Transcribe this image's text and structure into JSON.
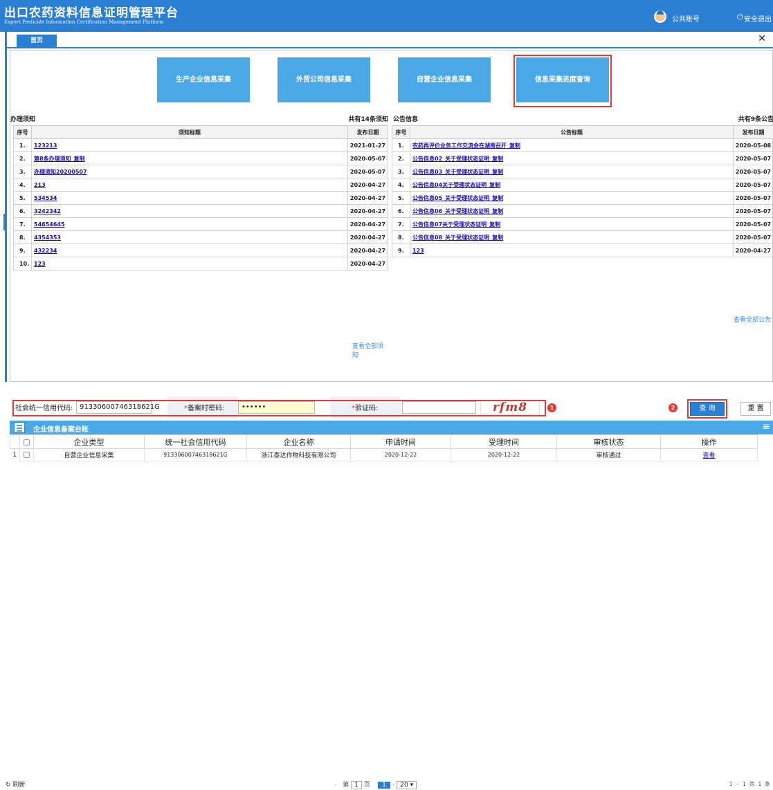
{
  "header": {
    "title": "出口农药资料信息证明管理平台",
    "subtitle": "Export Pesticide Information Certification Management Platform",
    "user_label": "公共账号",
    "logout_label": "安全退出"
  },
  "tabs": [
    {
      "label": "首页"
    }
  ],
  "tiles": [
    {
      "label": "生产企业信息采集"
    },
    {
      "label": "外贸公司信息采集"
    },
    {
      "label": "自营企业信息采集"
    },
    {
      "label": "信息采集进度查询"
    }
  ],
  "notice_panel": {
    "title": "办理须知",
    "count": "共有14条须知",
    "col_index": "序号",
    "col_title": "须知标题",
    "col_date": "发布日期",
    "more": "查看全部须知",
    "rows": [
      {
        "idx": "1.",
        "title": "123213",
        "date": "2021-01-27"
      },
      {
        "idx": "2.",
        "title": "第8条办理须知_复制",
        "date": "2020-05-07"
      },
      {
        "idx": "3.",
        "title": "办理须知20200507",
        "date": "2020-05-07"
      },
      {
        "idx": "4.",
        "title": "213",
        "date": "2020-04-27"
      },
      {
        "idx": "5.",
        "title": "534534",
        "date": "2020-04-27"
      },
      {
        "idx": "6.",
        "title": "3242342",
        "date": "2020-04-27"
      },
      {
        "idx": "7.",
        "title": "54654645",
        "date": "2020-04-27"
      },
      {
        "idx": "8.",
        "title": "4354353",
        "date": "2020-04-27"
      },
      {
        "idx": "9.",
        "title": "432234",
        "date": "2020-04-27"
      },
      {
        "idx": "10.",
        "title": "123",
        "date": "2020-04-27"
      }
    ]
  },
  "announce_panel": {
    "title": "公告信息",
    "count": "共有9条公告",
    "col_index": "序号",
    "col_title": "公告标题",
    "col_date": "发布日期",
    "more": "查看全部公告",
    "rows": [
      {
        "idx": "1.",
        "title": "农药再评价业务工作交流会在湖南召开_复制",
        "date": "2020-05-08"
      },
      {
        "idx": "2.",
        "title": "公告信息02_关于受理状态证明_复制",
        "date": "2020-05-07"
      },
      {
        "idx": "3.",
        "title": "公告信息03_关于受理状态证明_复制",
        "date": "2020-05-07"
      },
      {
        "idx": "4.",
        "title": "公告信息04关于受理状态证明_复制",
        "date": "2020-05-07"
      },
      {
        "idx": "5.",
        "title": "公告信息05_关于受理状态证明_复制",
        "date": "2020-05-07"
      },
      {
        "idx": "6.",
        "title": "公告信息06_关于受理状态证明_复制",
        "date": "2020-05-07"
      },
      {
        "idx": "7.",
        "title": "公告信息07关于受理状态证明_复制",
        "date": "2020-05-07"
      },
      {
        "idx": "8.",
        "title": "公告信息08_关于受理状态证明_复制",
        "date": "2020-05-07"
      },
      {
        "idx": "9.",
        "title": "123",
        "date": "2020-04-27"
      }
    ]
  },
  "search": {
    "credit_code_label": "社会统一信用代码:",
    "credit_code_value": "91330600746318621G",
    "password_label": "备案时密码:",
    "password_value": "••••••",
    "captcha_label": "验证码:",
    "captcha_value": "",
    "captcha_image_text": "rfm8",
    "badge1": "1",
    "badge2": "2",
    "query_label": "查 询",
    "reset_label": "重 置"
  },
  "grid": {
    "title": "企业信息备案台账",
    "columns": [
      "企业类型",
      "统一社会信用代码",
      "企业名称",
      "申请时间",
      "受理时间",
      "审核状态",
      "操作"
    ],
    "rows": [
      {
        "num": "1",
        "type": "自营企业信息采集",
        "code": "91330600746318621G",
        "name": "浙江泰达作物科技有限公司",
        "apply": "2020-12-22",
        "accept": "2020-12-22",
        "status": "审核通过",
        "action": "查看"
      }
    ]
  },
  "footer": {
    "refresh": "刷新",
    "page_prefix": "第",
    "page_value": "1",
    "page_suffix": "页",
    "page_current": "1",
    "page_size": "20 ▾",
    "summary": "1 - 1  共 1 条"
  },
  "colors": {
    "primary": "#2a7fd3",
    "tile": "#4aa8e6",
    "highlight": "#e53935"
  }
}
